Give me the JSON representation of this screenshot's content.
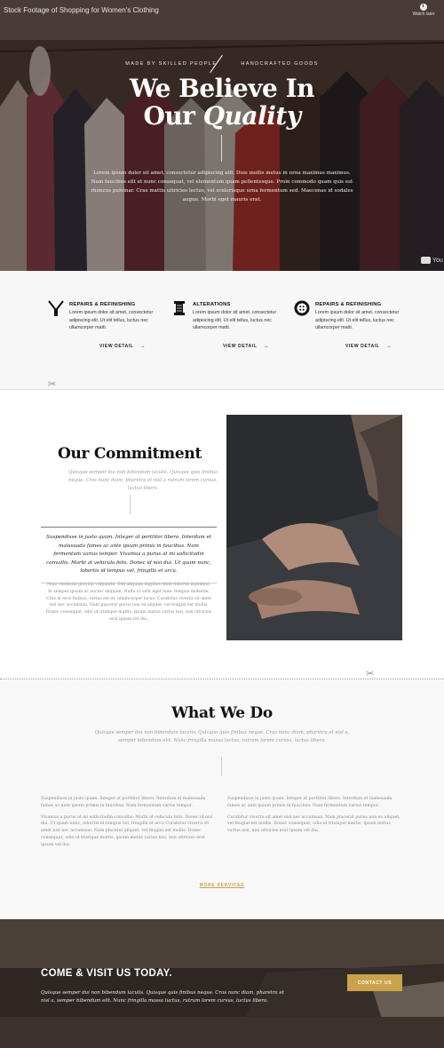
{
  "hero": {
    "video_title": "Stock Footage of Shopping for Women's Clothing",
    "watch_later": "Watch later",
    "eyebrow_left": "MADE BY SKILLED PEOPLE",
    "eyebrow_right": "HANDCRAFTED GOODS",
    "title_line1": "We Believe In",
    "title_line2_plain": "Our",
    "title_line2_italic": "Quality",
    "text": "Lorem ipsum dolor sit amet, consectetur adipiscing elit. Duis mollis metus in urna maximus maximus. Nam faucibus elit et nunc consequat, vel elementum quam pellentesque. Proin commodo quam quis est rhoncus pulvinar. Cras mattis ultricies lectus, vel scelerisque urna fermentum sed. Maecenas id sodales augue. Morbi eget mauris erat.",
    "youtube": "You"
  },
  "services": [
    {
      "icon": "tweezers-icon",
      "title": "REPAIRS & REFINISHING",
      "text": "Lorem ipsum dolor sit amet, consectetur adipiscing elit. Ut elit tellus, luctus nec ullamcorper matti.",
      "link": "VIEW DETAIL"
    },
    {
      "icon": "thread-spool-icon",
      "title": "ALTERATIONS",
      "text": "Lorem ipsum dolor sit amet, consectetur adipiscing elit. Ut elit tellus, luctus nec ullamcorper matti.",
      "link": "VIEW DETAIL"
    },
    {
      "icon": "button-icon",
      "title": "REPAIRS & REFINISHING",
      "text": "Lorem ipsum dolor sit amet, consectetur adipiscing elit. Ut elit tellus, luctus nec ullamcorper matti.",
      "link": "VIEW DETAIL"
    }
  ],
  "commitment": {
    "title": "Our Commitment",
    "subtitle": "Quisque semper dui non bibendum iaculis. Quisque quis finibus neque. Cras nunc diam, pharetra et nisl a rutrum lorem cursus, luctus libero.",
    "quote": "Suspendisse in justo quam. Integer at porttitor libero. Interdum et malesuada fames ac ante ipsum primis in faucibus. Nam fermentum varius tempor. Vivamus a purus at mi sollicitudin convallis. Morbi at vehicula felis. Donec id nisi dui. Ut quam nunc, lobortis id tempus vel, fringilla et arcu.",
    "body": "Nunc molestie gravida vulputate. Sed aliquam dapibus enim lobortis maximus. In semper ipsum ac auctor aliquam. Nulla ut velit eget nunc tempus molestie. Cras in eros finibus, varius est et, ullamcorper lacus. Curabitur viverra sit amet nisl nec accumsan. Nam placerat purus non ex aliquet, vel feugiat est mollis. Donec consequat, odio id tristique mattis, ipsum metus varius nisi, non ultricies erat ipsum vel dui."
  },
  "what_we_do": {
    "title": "What We Do",
    "subtitle": "Quisque semper dui non bibendum iaculis. Quisque quis finibus neque. Cras nunc diam, pharetra et nisl a, semper bibendum elit. Nunc fringilla massa luctus, rutrum lorem cursus, luctus libero.",
    "col1_p1": "Suspendisse in justo quam. Integer at porttitor libero. Interdum et malesuada fames ac ante ipsum primis in faucibus. Nam fermentum varius tempor.",
    "col1_p2": "Vivamus a purus at mi sollicitudin convallis. Morbi at vehicula felis. Donec id nisi dui. Ut quam nunc, lobortis id tempus vel, fringilla et arcu Curabitur viverra sit amet nisl nec accumsan. Nam placerat aliquet, vel feugiat est mollis. Donec consequat, odio id tristique mattis, ipsum metus varius nisi, non ultricies erat ipsum vel dui.",
    "col2_p1": "Suspendisse in justo quam. Integer at porttitor libero. Interdum et malesuada fames ac ante ipsum primis in faucibus. Nam fermentum varius tempor.",
    "col2_p2": "Curabitur viverra sit amet nisl nec accumsan. Nam placerat purus non ex aliquet, vel feugiat est mollis. Donec consequat, odio id tristique mattis, ipsum metus varius nisi, non ultricies erat ipsum vel dui.",
    "more_link": "MORE SERVICES"
  },
  "visit": {
    "title": "COME & VISIT US TODAY.",
    "text": "Quisque semper dui non bibendum iaculis. Quisque quis finibus neque. Cras nunc diam, pharetra et nisl a, semper bibendum elit. Nunc fringilla massa luctus, rutrum lorem cursus, luctus libero.",
    "button": "CONTACT US"
  },
  "colors": {
    "accent": "#c9a24a",
    "dark": "#111111",
    "muted": "#999999"
  }
}
